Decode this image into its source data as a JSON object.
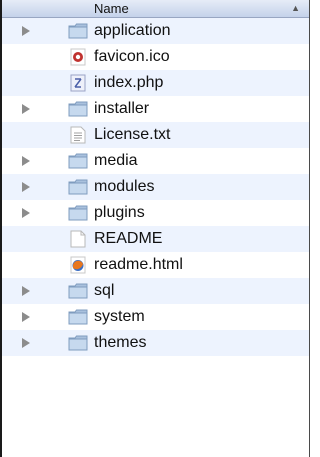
{
  "header": {
    "column_label": "Name",
    "sort_indicator": "▲"
  },
  "items": [
    {
      "name": "application",
      "kind": "folder",
      "expandable": true,
      "icon": "folder-icon"
    },
    {
      "name": "favicon.ico",
      "kind": "file",
      "expandable": false,
      "icon": "ico-file-icon"
    },
    {
      "name": "index.php",
      "kind": "file",
      "expandable": false,
      "icon": "php-file-icon"
    },
    {
      "name": "installer",
      "kind": "folder",
      "expandable": true,
      "icon": "folder-icon"
    },
    {
      "name": "License.txt",
      "kind": "file",
      "expandable": false,
      "icon": "text-file-icon"
    },
    {
      "name": "media",
      "kind": "folder",
      "expandable": true,
      "icon": "folder-icon"
    },
    {
      "name": "modules",
      "kind": "folder",
      "expandable": true,
      "icon": "folder-icon"
    },
    {
      "name": "plugins",
      "kind": "folder",
      "expandable": true,
      "icon": "folder-icon"
    },
    {
      "name": "README",
      "kind": "file",
      "expandable": false,
      "icon": "document-icon"
    },
    {
      "name": "readme.html",
      "kind": "file",
      "expandable": false,
      "icon": "html-file-icon"
    },
    {
      "name": "sql",
      "kind": "folder",
      "expandable": true,
      "icon": "folder-icon"
    },
    {
      "name": "system",
      "kind": "folder",
      "expandable": true,
      "icon": "folder-icon"
    },
    {
      "name": "themes",
      "kind": "folder",
      "expandable": true,
      "icon": "folder-icon"
    }
  ]
}
